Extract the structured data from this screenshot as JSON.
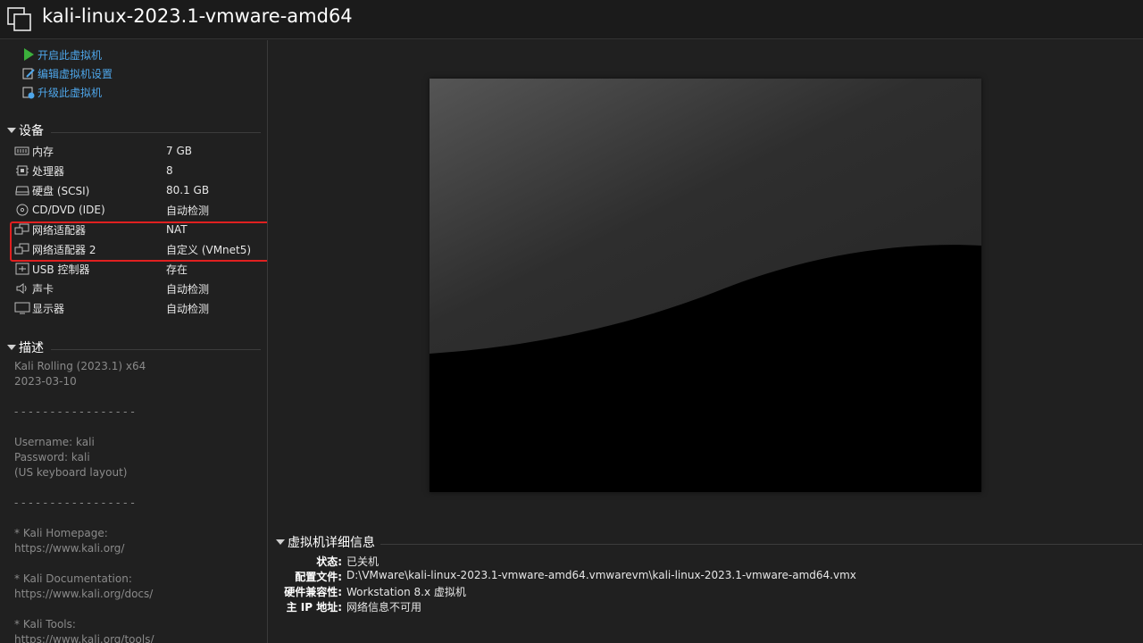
{
  "window": {
    "title": "kali-linux-2023.1-vmware-amd64"
  },
  "actions": [
    {
      "label": "开启此虚拟机",
      "icon": "play-icon"
    },
    {
      "label": "编辑虚拟机设置",
      "icon": "edit-settings-icon"
    },
    {
      "label": "升级此虚拟机",
      "icon": "upgrade-icon"
    }
  ],
  "devices": {
    "title": "设备",
    "items": [
      {
        "name": "内存",
        "value": "7 GB",
        "icon": "memory-icon"
      },
      {
        "name": "处理器",
        "value": "8",
        "icon": "processor-icon"
      },
      {
        "name": "硬盘 (SCSI)",
        "value": "80.1 GB",
        "icon": "hard-disk-icon"
      },
      {
        "name": "CD/DVD (IDE)",
        "value": "自动检测",
        "icon": "cd-dvd-icon"
      },
      {
        "name": "网络适配器",
        "value": "NAT",
        "icon": "network-adapter-icon"
      },
      {
        "name": "网络适配器 2",
        "value": "自定义 (VMnet5)",
        "icon": "network-adapter-icon"
      },
      {
        "name": "USB 控制器",
        "value": "存在",
        "icon": "usb-icon"
      },
      {
        "name": "声卡",
        "value": "自动检测",
        "icon": "sound-card-icon"
      },
      {
        "name": "显示器",
        "value": "自动检测",
        "icon": "display-icon"
      }
    ]
  },
  "description": {
    "title": "描述",
    "lines": [
      "Kali Rolling (2023.1) x64",
      "2023-03-10",
      "",
      "- - - - - - - - - - - - - - - - -",
      "",
      "Username: kali",
      "Password: kali",
      "(US keyboard layout)",
      "",
      "- - - - - - - - - - - - - - - - -",
      "",
      "* Kali Homepage:",
      "https://www.kali.org/",
      "",
      "* Kali Documentation:",
      "https://www.kali.org/docs/",
      "",
      "* Kali Tools:",
      "https://www.kali.org/tools/"
    ]
  },
  "details": {
    "title": "虚拟机详细信息",
    "rows": [
      {
        "key": "状态:",
        "value": "已关机"
      },
      {
        "key": "配置文件:",
        "value": "D:\\VMware\\kali-linux-2023.1-vmware-amd64.vmwarevm\\kali-linux-2023.1-vmware-amd64.vmx"
      },
      {
        "key": "硬件兼容性:",
        "value": "Workstation 8.x 虚拟机"
      },
      {
        "key": "主 IP 地址:",
        "value": "网络信息不可用"
      }
    ]
  },
  "colors": {
    "link": "#4ea6ea",
    "play_green": "#3cb03c",
    "highlight_red": "#e02020",
    "background": "#202020"
  }
}
